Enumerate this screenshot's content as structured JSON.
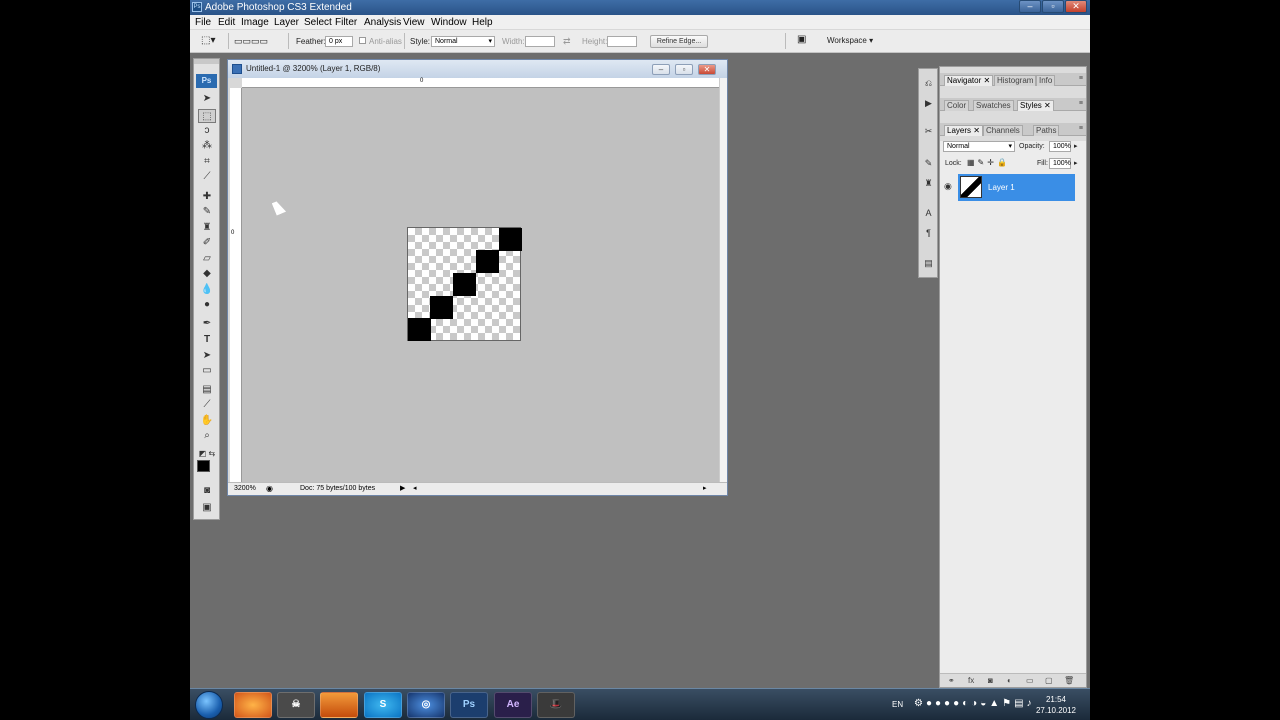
{
  "app": {
    "title": "Adobe Photoshop CS3 Extended"
  },
  "menu": [
    "File",
    "Edit",
    "Image",
    "Layer",
    "Select",
    "Filter",
    "Analysis",
    "View",
    "Window",
    "Help"
  ],
  "options": {
    "feather_label": "Feather:",
    "feather_value": "0 px",
    "antialias_label": "Anti-alias",
    "style_label": "Style:",
    "style_value": "Normal",
    "width_label": "Width:",
    "height_label": "Height:",
    "refine_edge": "Refine Edge...",
    "workspace": "Workspace"
  },
  "toolbox": {
    "logo": "Ps"
  },
  "document": {
    "title": "Untitled-1 @ 3200% (Layer 1, RGB/8)",
    "zoom": "3200%",
    "doc_info": "Doc: 75 bytes/100 bytes",
    "ruler_zero_top": "0",
    "ruler_zero_left": "0"
  },
  "panels": {
    "group1_tabs": [
      "Navigator",
      "Histogram",
      "Info"
    ],
    "group2_tabs": [
      "Color",
      "Swatches",
      "Styles"
    ],
    "group3_tabs": [
      "Layers",
      "Channels",
      "Paths"
    ],
    "blend_mode": "Normal",
    "opacity_label": "Opacity:",
    "opacity_value": "100%",
    "lock_label": "Lock:",
    "fill_label": "Fill:",
    "fill_value": "100%",
    "layer_name": "Layer 1"
  },
  "taskbar": {
    "apps": [
      "firefox",
      "game",
      "files",
      "skype",
      "browser",
      "Ps",
      "Ae",
      "hat"
    ],
    "lang": "EN",
    "time": "21:54",
    "date": "27.10.2012"
  }
}
